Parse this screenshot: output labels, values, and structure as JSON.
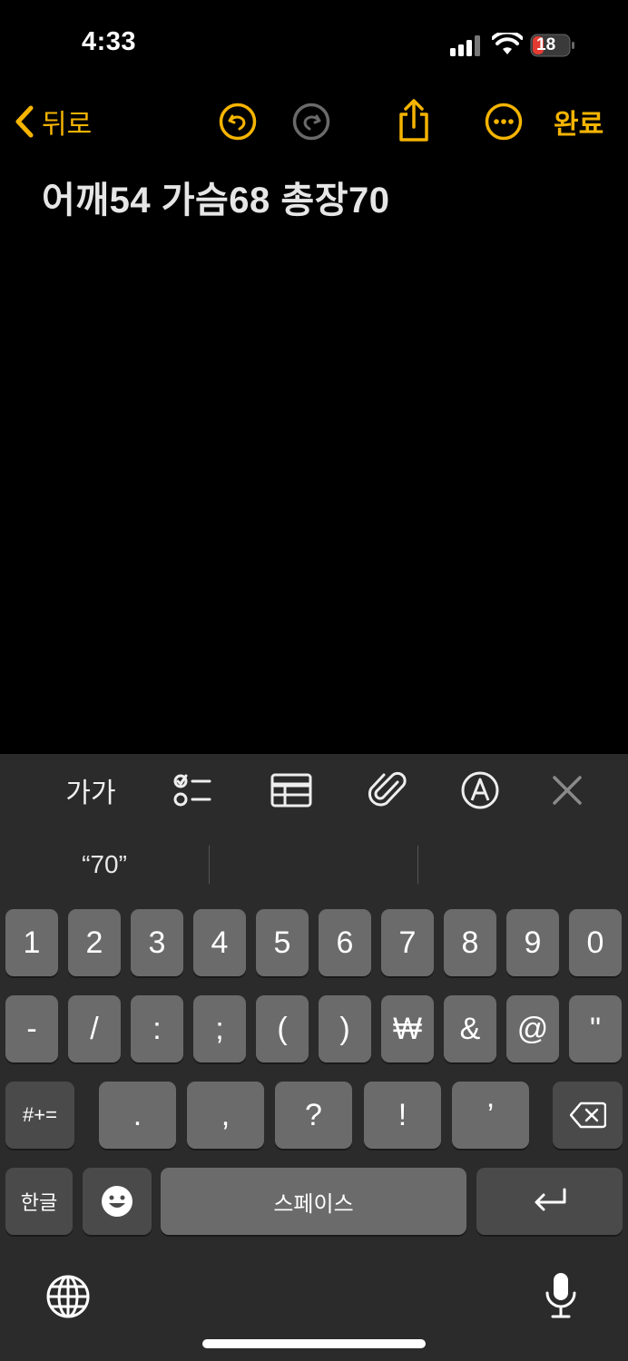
{
  "status_bar": {
    "time": "4:33",
    "battery_level": "18"
  },
  "nav": {
    "back_label": "뒤로",
    "done_label": "완료",
    "accent_color": "#F5B400",
    "icons": [
      "undo-icon",
      "redo-icon",
      "share-icon",
      "more-icon"
    ]
  },
  "note": {
    "text": "어깨54 가슴68 총장70"
  },
  "format_toolbar": {
    "aa_label": "가가",
    "icons": [
      "checklist-icon",
      "table-icon",
      "attachment-icon",
      "markup-icon",
      "close-icon"
    ]
  },
  "keyboard": {
    "suggestions": [
      "“70”",
      "",
      ""
    ],
    "row1": [
      "1",
      "2",
      "3",
      "4",
      "5",
      "6",
      "7",
      "8",
      "9",
      "0"
    ],
    "row2": [
      "-",
      "/",
      ":",
      ";",
      "(",
      ")",
      "₩",
      "&",
      "@",
      "\""
    ],
    "row3_left": "#+=",
    "row3": [
      ".",
      ",",
      "?",
      "!",
      "’"
    ],
    "hangul_label": "한글",
    "space_label": "스페이스",
    "icons": [
      "delete-icon",
      "emoji-icon",
      "return-icon",
      "globe-icon",
      "microphone-icon"
    ]
  }
}
